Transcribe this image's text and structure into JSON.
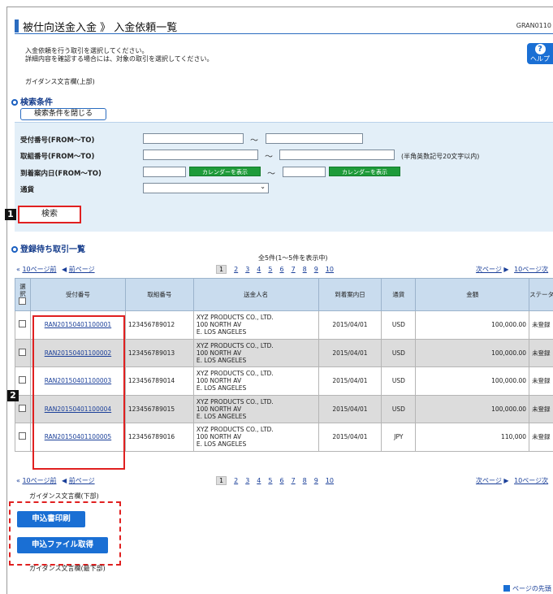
{
  "header": {
    "title": "被仕向送金入金 》 入金依頼一覧",
    "screen_id": "GRAN0110",
    "help_label": "ヘルプ"
  },
  "intro": {
    "line1": "入金依頼を行う取引を選択してください。",
    "line2": "詳細内容を確認する場合には、対象の取引を選択してください。",
    "guidance_top": "ガイダンス文言欄(上部)"
  },
  "search": {
    "heading": "検索条件",
    "close_label": "検索条件を閉じる",
    "receipt_label": "受付番号(FROM〜TO)",
    "ref_label": "取組番号(FROM〜TO)",
    "ref_note": "(半角英数記号20文字以内)",
    "arrival_label": "到着案内日(FROM〜TO)",
    "currency_label": "通貨",
    "calendar_label": "カレンダーを表示",
    "tilde": "〜",
    "search_button": "検索"
  },
  "list": {
    "heading": "登録待ち取引一覧",
    "count_text": "全5件(1〜5件を表示中)",
    "prev10": "10ページ前",
    "prev": "前ページ",
    "next": "次ページ",
    "next10": "10ページ次",
    "pages": [
      "1",
      "2",
      "3",
      "4",
      "5",
      "6",
      "7",
      "8",
      "9",
      "10"
    ],
    "columns": {
      "select": "選択",
      "receipt_no": "受付番号",
      "ref_no": "取組番号",
      "remitter": "送金人名",
      "arrival_date": "到着案内日",
      "currency": "通貨",
      "amount": "金額",
      "status": "ステータス"
    },
    "rows": [
      {
        "receipt": "RAN20150401100001",
        "ref": "123456789012",
        "name1": "XYZ PRODUCTS CO., LTD.",
        "name2": "100 NORTH AV",
        "name3": "E. LOS ANGELES",
        "date": "2015/04/01",
        "currency": "USD",
        "amount": "100,000.00",
        "status": "未登録"
      },
      {
        "receipt": "RAN20150401100002",
        "ref": "123456789013",
        "name1": "XYZ PRODUCTS CO., LTD.",
        "name2": "100 NORTH AV",
        "name3": "E. LOS ANGELES",
        "date": "2015/04/01",
        "currency": "USD",
        "amount": "100,000.00",
        "status": "未登録"
      },
      {
        "receipt": "RAN20150401100003",
        "ref": "123456789014",
        "name1": "XYZ PRODUCTS CO., LTD.",
        "name2": "100 NORTH AV",
        "name3": "E. LOS ANGELES",
        "date": "2015/04/01",
        "currency": "USD",
        "amount": "100,000.00",
        "status": "未登録"
      },
      {
        "receipt": "RAN20150401100004",
        "ref": "123456789015",
        "name1": "XYZ PRODUCTS CO., LTD.",
        "name2": "100 NORTH AV",
        "name3": "E. LOS ANGELES",
        "date": "2015/04/01",
        "currency": "USD",
        "amount": "100,000.00",
        "status": "未登録"
      },
      {
        "receipt": "RAN20150401100005",
        "ref": "123456789016",
        "name1": "XYZ PRODUCTS CO., LTD.",
        "name2": "100 NORTH AV",
        "name3": "E. LOS ANGELES",
        "date": "2015/04/01",
        "currency": "JPY",
        "amount": "110,000",
        "status": "未登録"
      }
    ]
  },
  "footer": {
    "guidance_bottom": "ガイダンス文言欄(下部)",
    "print_button": "申込書印刷",
    "file_button": "申込ファイル取得",
    "guidance_last": "ガイダンス文言欄(最下部)",
    "page_top": "ページの先頭"
  },
  "markers": {
    "m1": "1",
    "m2": "2"
  },
  "colors": {
    "accent": "#1a6fd4",
    "highlight": "#e02020",
    "calendar": "#1e9b3a"
  }
}
